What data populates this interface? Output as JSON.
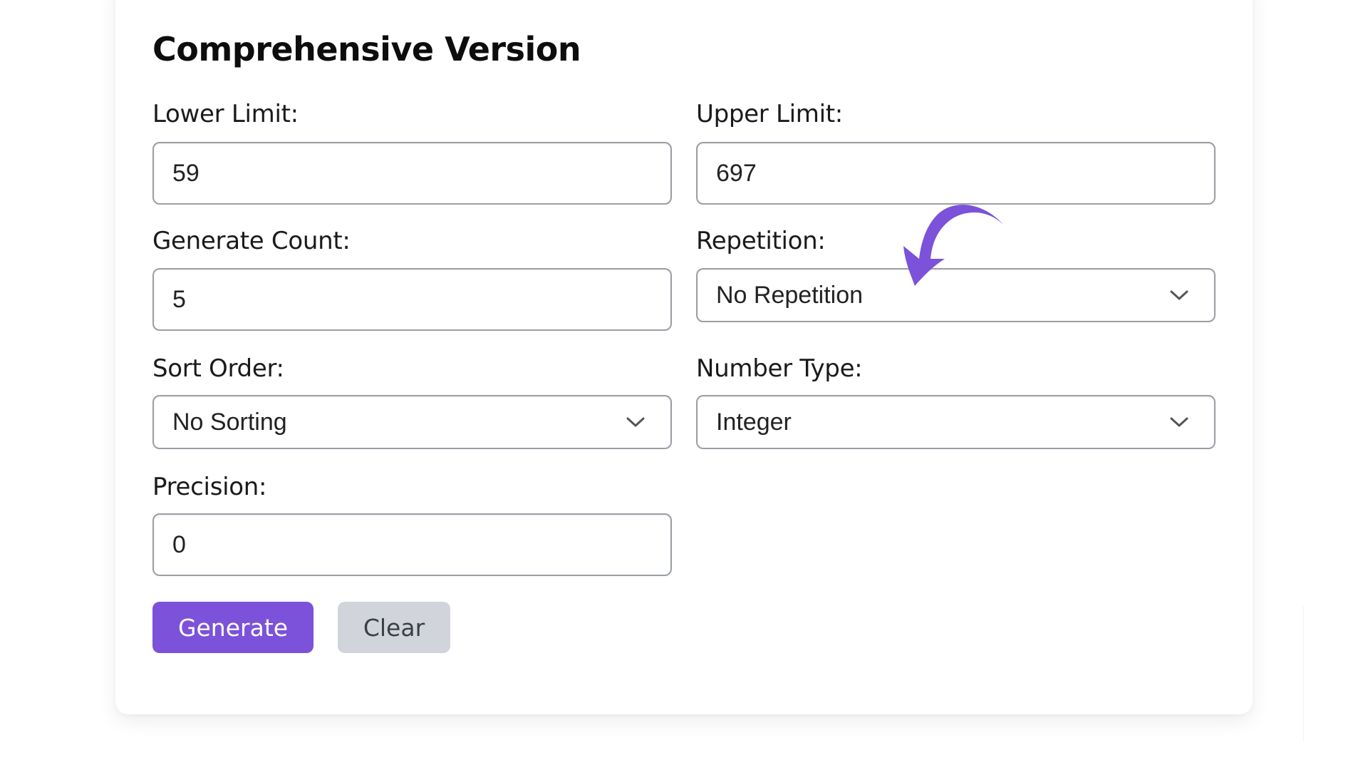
{
  "title": "Comprehensive Version",
  "fields": {
    "lower_limit": {
      "label": "Lower Limit:",
      "value": "59"
    },
    "upper_limit": {
      "label": "Upper Limit:",
      "value": "697"
    },
    "generate_count": {
      "label": "Generate Count:",
      "value": "5"
    },
    "repetition": {
      "label": "Repetition:",
      "value": "No Repetition"
    },
    "sort_order": {
      "label": "Sort Order:",
      "value": "No Sorting"
    },
    "number_type": {
      "label": "Number Type:",
      "value": "Integer"
    },
    "precision": {
      "label": "Precision:",
      "value": "0"
    }
  },
  "buttons": {
    "generate": "Generate",
    "clear": "Clear"
  },
  "annotation": {
    "icon": "curved-arrow-icon",
    "color": "#7b52d9"
  },
  "colors": {
    "accent": "#7b52d9",
    "secondary_button": "#d1d5db"
  }
}
